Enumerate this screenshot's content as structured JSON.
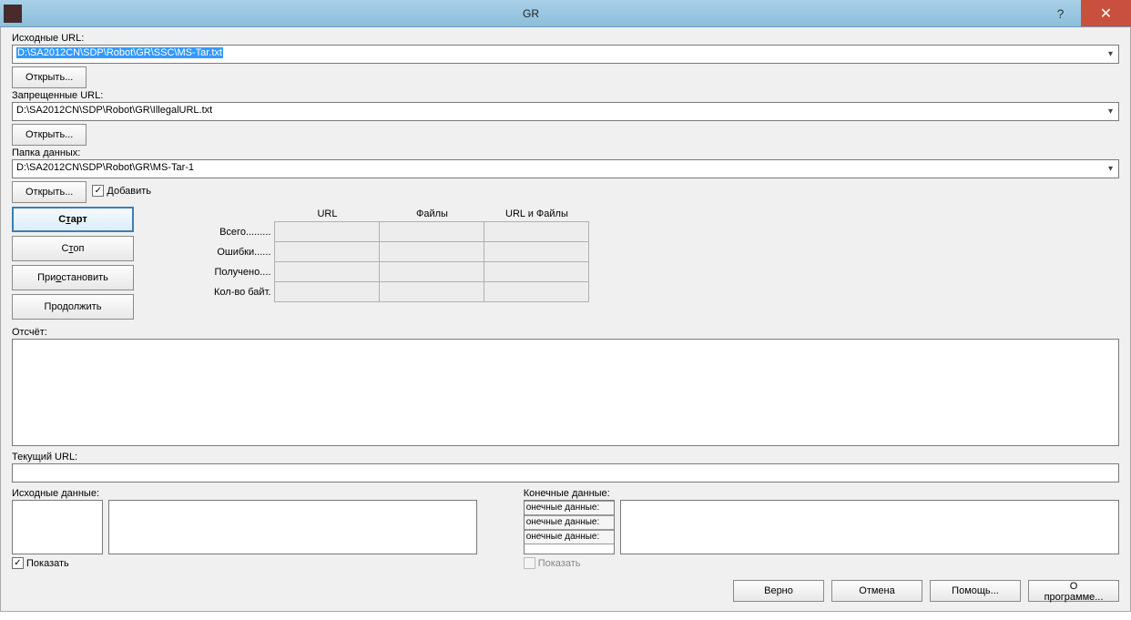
{
  "title": "GR",
  "labels": {
    "source_url": "Исходные URL:",
    "forbidden_url": "Запрещенные URL:",
    "data_folder": "Папка данных:",
    "report": "Отсчёт:",
    "current_url": "Текущий URL:",
    "source_data": "Исходные данные:",
    "final_data": "Конечные данные:"
  },
  "values": {
    "source_url": "D:\\SA2012CN\\SDP\\Robot\\GR\\SSC\\MS-Tar.txt",
    "forbidden_url": "D:\\SA2012CN\\SDP\\Robot\\GR\\IllegalURL.txt",
    "data_folder": "D:\\SA2012CN\\SDP\\Robot\\GR\\MS-Tar-1"
  },
  "buttons": {
    "open": "Открыть...",
    "add": "Добавить",
    "start_pre": "С",
    "start_u": "т",
    "start_post": "арт",
    "stop_pre": "С",
    "stop_u": "т",
    "stop_post": "оп",
    "pause_pre": "При",
    "pause_u": "о",
    "pause_post": "становить",
    "resume": "Продолжить",
    "show": "Показать",
    "ok": "Верно",
    "cancel": "Отмена",
    "help": "Помощь...",
    "about": "О программе..."
  },
  "stats": {
    "col_url": "URL",
    "col_files": "Файлы",
    "col_both": "URL  и  Файлы",
    "row_total": "Всего.........",
    "row_errors": "Ошибки......",
    "row_received": "Получено....",
    "row_bytes": "Кол-во байт."
  },
  "listlines": {
    "l1": "онечные данные:",
    "l2": "онечные данные:",
    "l3": "онечные данные:"
  }
}
